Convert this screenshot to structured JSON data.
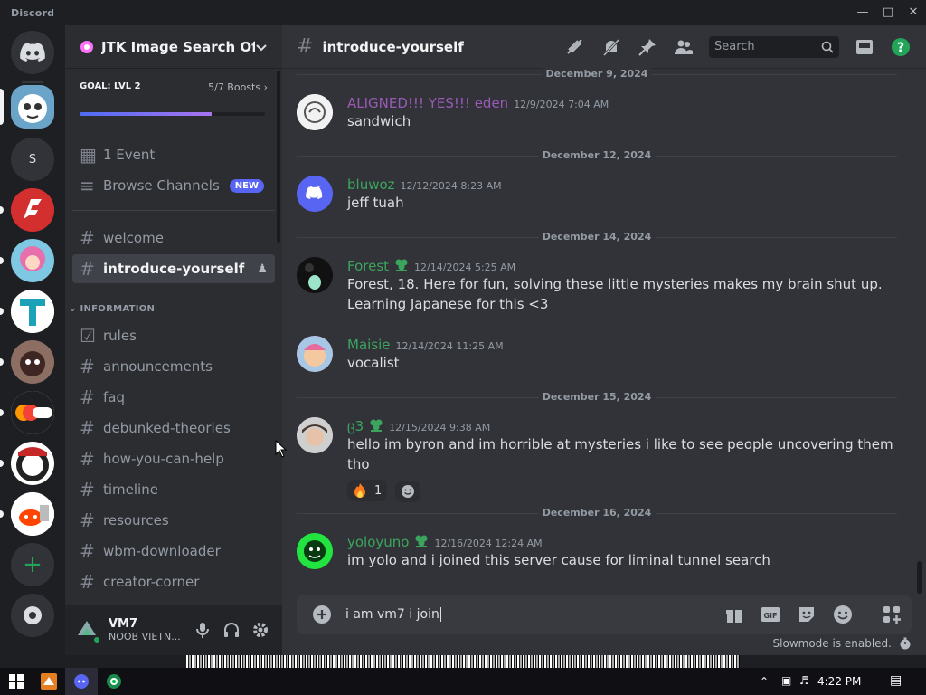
{
  "window": {
    "title": "Discord"
  },
  "guild": {
    "name": "JTK Image Search Of..."
  },
  "boost": {
    "goal": "GOAL: LVL 2",
    "count": "5/7 Boosts",
    "progress": 0.71
  },
  "nav": {
    "events": "1 Event",
    "browse": "Browse Channels",
    "new_badge": "NEW"
  },
  "channels": {
    "welcome": "welcome",
    "introduce": "introduce-yourself",
    "category_information": "INFORMATION",
    "rules": "rules",
    "announcements": "announcements",
    "faq": "faq",
    "debunked": "debunked-theories",
    "how": "how-you-can-help",
    "timeline": "timeline",
    "resources": "resources",
    "wbm": "wbm-downloader",
    "creator": "creator-corner"
  },
  "user": {
    "name": "VM7",
    "status": "NOOB VIETN..."
  },
  "chat": {
    "channel": "introduce-yourself",
    "search_placeholder": "Search",
    "composer_text": "i am vm7 i join",
    "slowmode": "Slowmode is enabled."
  },
  "messages": [
    {
      "date": "December 9, 2024",
      "author": "ALIGNED!!! YES!!! eden",
      "color": "#9b59b6",
      "time": "12/9/2024 7:04 AM",
      "text": "sandwich"
    },
    {
      "date": "December 12, 2024",
      "author": "bluwoz",
      "color": "#3ba55d",
      "time": "12/12/2024 8:23 AM",
      "text": "jeff tuah"
    },
    {
      "date": "December 14, 2024",
      "author": "Forest",
      "color": "#3ba55d",
      "time": "12/14/2024 5:25 AM",
      "text": "Forest, 18. Here for fun, solving these little mysteries makes my brain shut up.",
      "text2": "Learning Japanese for this <3"
    },
    {
      "author": "Maisie",
      "color": "#3ba55d",
      "time": "12/14/2024 11:25 AM",
      "text": "vocalist"
    },
    {
      "date": "December 15, 2024",
      "author": "ც3",
      "color": "#3ba55d",
      "time": "12/15/2024 9:38 AM",
      "text": "hello im byron and im horrible at mysteries i like to see people uncovering them tho",
      "reaction_count": "1"
    },
    {
      "date": "December 16, 2024",
      "author": "yoloyuno",
      "color": "#3ba55d",
      "time": "12/16/2024 12:24 AM",
      "text": "im yolo and i joined this server cause for liminal tunnel search"
    }
  ],
  "taskbar": {
    "time": "4:22 PM"
  },
  "colors": {
    "accent": "#5865f2",
    "green": "#3ba55d",
    "bg": "#313338"
  }
}
